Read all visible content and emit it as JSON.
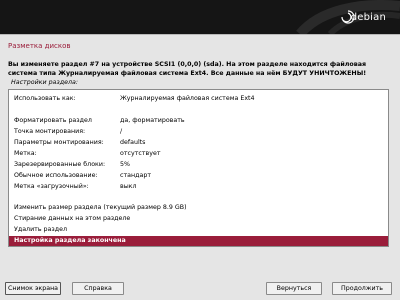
{
  "header": {
    "logo_text": "debian",
    "logo_mark": "debian-swirl-icon"
  },
  "page": {
    "title": "Разметка дисков",
    "description": "Вы изменяете раздел #7 на устройстве SCSI1 (0,0,0) (sda). На этом разделе находится файловая система типа Журналируемая файловая система Ext4. Все данные на нём БУДУТ УНИЧТОЖЕНЫ!",
    "list_caption": "Настройки раздела:"
  },
  "settings": [
    {
      "key": "Использовать как:",
      "value": "Журналируемая файловая система Ext4"
    },
    {
      "key": "",
      "value": ""
    },
    {
      "key": "Форматировать раздел",
      "value": "да, форматировать"
    },
    {
      "key": "Точка монтирования:",
      "value": "/"
    },
    {
      "key": "Параметры монтирования:",
      "value": "defaults"
    },
    {
      "key": "Метка:",
      "value": "отсутствует"
    },
    {
      "key": "Зарезервированные блоки:",
      "value": "5%"
    },
    {
      "key": "Обычное использование:",
      "value": "стандарт"
    },
    {
      "key": "Метка «загрузочный»:",
      "value": "выкл"
    },
    {
      "key": "",
      "value": ""
    },
    {
      "key": "Изменить размер раздела (текущий размер 8.9 GB)",
      "value": ""
    },
    {
      "key": "Стирание данных на этом разделе",
      "value": ""
    },
    {
      "key": "Удалить раздел",
      "value": ""
    },
    {
      "key": "Настройка раздела закончена",
      "value": "",
      "selected": true
    }
  ],
  "buttons": {
    "screenshot": "Снимок экрана",
    "help": "Справка",
    "back": "Вернуться",
    "continue": "Продолжить"
  },
  "colors": {
    "accent": "#9a1d3a",
    "banner": "#151515",
    "background": "#e5e5e5"
  }
}
